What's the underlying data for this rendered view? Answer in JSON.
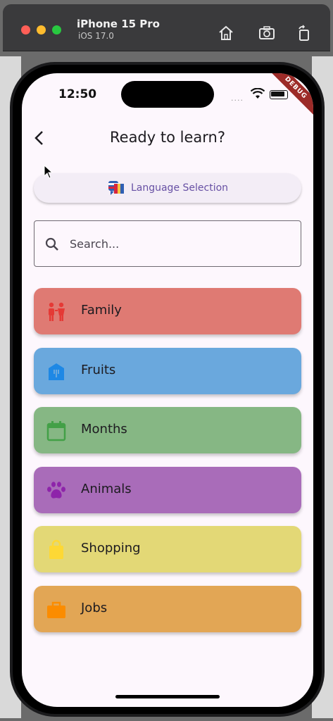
{
  "simulator": {
    "device_name": "iPhone 15 Pro",
    "os_version": "iOS 17.0"
  },
  "status_bar": {
    "time": "12:50",
    "signal_dots": "....",
    "debug_banner": "DEBUG"
  },
  "header": {
    "title": "Ready to learn?"
  },
  "language_button": {
    "label": "Language Selection",
    "accent": "#6750a4"
  },
  "search": {
    "placeholder": "Search...",
    "value": ""
  },
  "categories": [
    {
      "label": "Family",
      "icon": "family-icon",
      "bg": "#df7a73",
      "icon_color": "#e53935"
    },
    {
      "label": "Fruits",
      "icon": "fruits-icon",
      "bg": "#6aa8dd",
      "icon_color": "#1e88e5"
    },
    {
      "label": "Months",
      "icon": "calendar-icon",
      "bg": "#86b784",
      "icon_color": "#43a047"
    },
    {
      "label": "Animals",
      "icon": "paw-icon",
      "bg": "#a96cb9",
      "icon_color": "#8e24aa"
    },
    {
      "label": "Shopping",
      "icon": "shopping-bag-icon",
      "bg": "#e3d876",
      "icon_color": "#fdd835"
    },
    {
      "label": "Jobs",
      "icon": "briefcase-icon",
      "bg": "#e2a655",
      "icon_color": "#fb8c00"
    }
  ]
}
